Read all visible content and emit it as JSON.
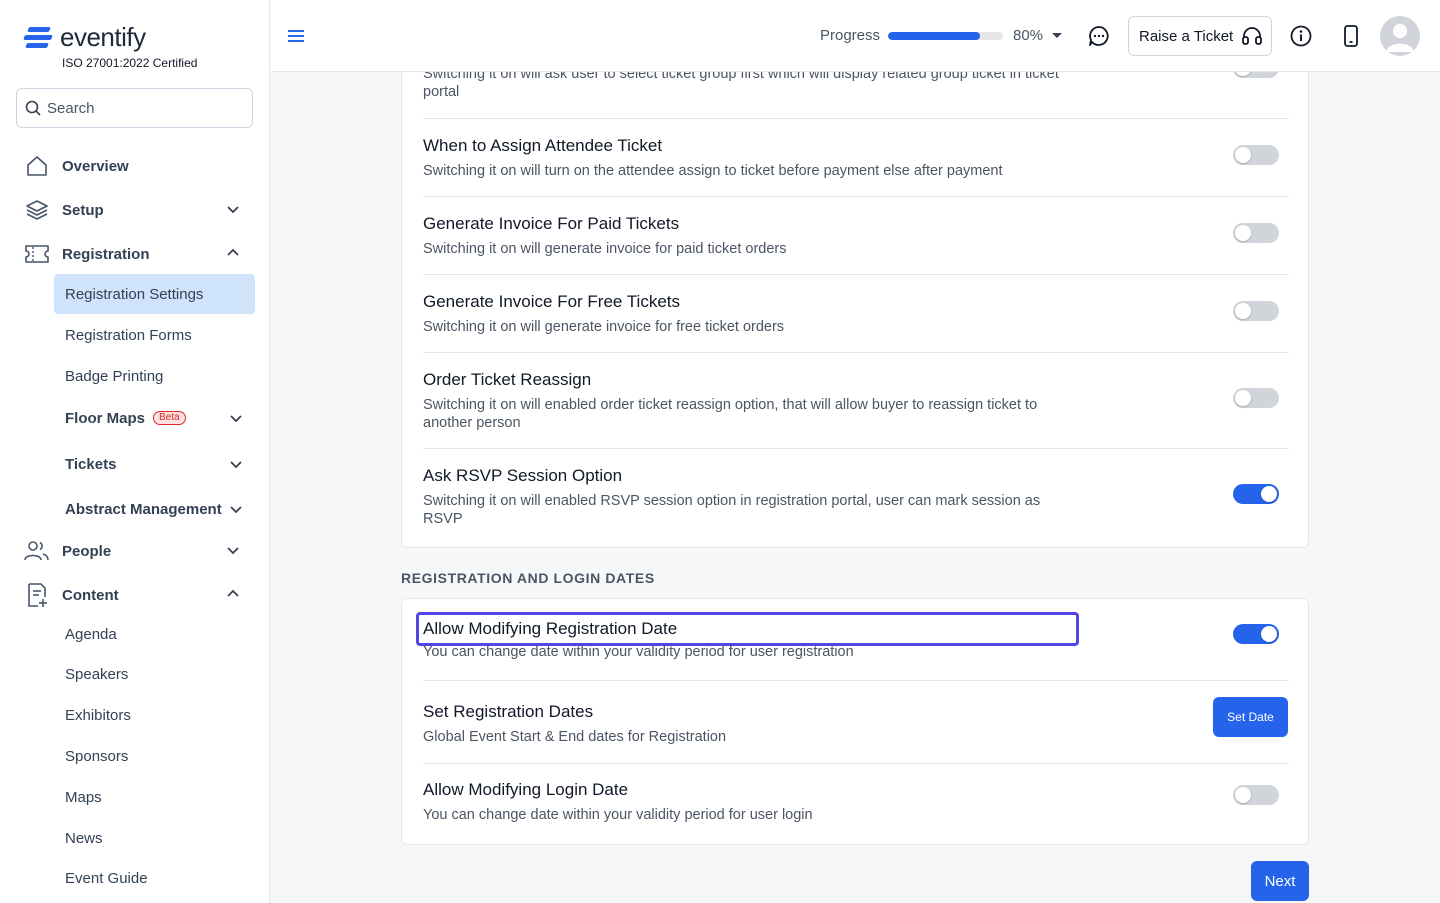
{
  "brand": {
    "name": "eventify",
    "certification": "ISO 27001:2022 Certified",
    "accent": "#2563eb"
  },
  "search": {
    "placeholder": "Search"
  },
  "sidebar": {
    "overview": "Overview",
    "setup": "Setup",
    "registration": "Registration",
    "registration_items": [
      "Registration Settings",
      "Registration Forms",
      "Badge Printing",
      "Floor Maps",
      "Tickets",
      "Abstract Management"
    ],
    "beta_badge": "Beta",
    "people": "People",
    "content": "Content",
    "content_items": [
      "Agenda",
      "Speakers",
      "Exhibitors",
      "Sponsors",
      "Maps",
      "News",
      "Event Guide"
    ]
  },
  "header": {
    "progress_label": "Progress",
    "progress_value": 80,
    "progress_text": "80%",
    "raise_ticket": "Raise a Ticket"
  },
  "settings_card": {
    "top_partial_desc": "Switching it on will ask user to select ticket group first which will display related group ticket in ticket portal",
    "rows": [
      {
        "title": "When to Assign Attendee Ticket",
        "desc": "Switching it on will turn on the attendee assign to ticket before payment else after payment",
        "on": false
      },
      {
        "title": "Generate Invoice For Paid Tickets",
        "desc": "Switching it on will generate invoice for paid ticket orders",
        "on": false
      },
      {
        "title": "Generate Invoice For Free Tickets",
        "desc": "Switching it on will generate invoice for free ticket orders",
        "on": false
      },
      {
        "title": "Order Ticket Reassign",
        "desc": "Switching it on will enabled order ticket reassign option, that will allow buyer to reassign ticket to another person",
        "on": false
      },
      {
        "title": "Ask RSVP Session Option",
        "desc": "Switching it on will enabled RSVP session option in registration portal, user can mark session as RSVP",
        "on": true
      }
    ]
  },
  "dates_section": {
    "title": "REGISTRATION AND LOGIN DATES",
    "rows": [
      {
        "title": "Allow Modifying Registration Date",
        "desc": "You can change date within your validity period for user registration",
        "on": true
      },
      {
        "title": "Set Registration Dates",
        "desc": "Global Event Start & End dates for Registration",
        "button": "Set Date"
      },
      {
        "title": "Allow Modifying Login Date",
        "desc": "You can change date within your validity period for user login",
        "on": false
      }
    ]
  },
  "next_button": "Next"
}
